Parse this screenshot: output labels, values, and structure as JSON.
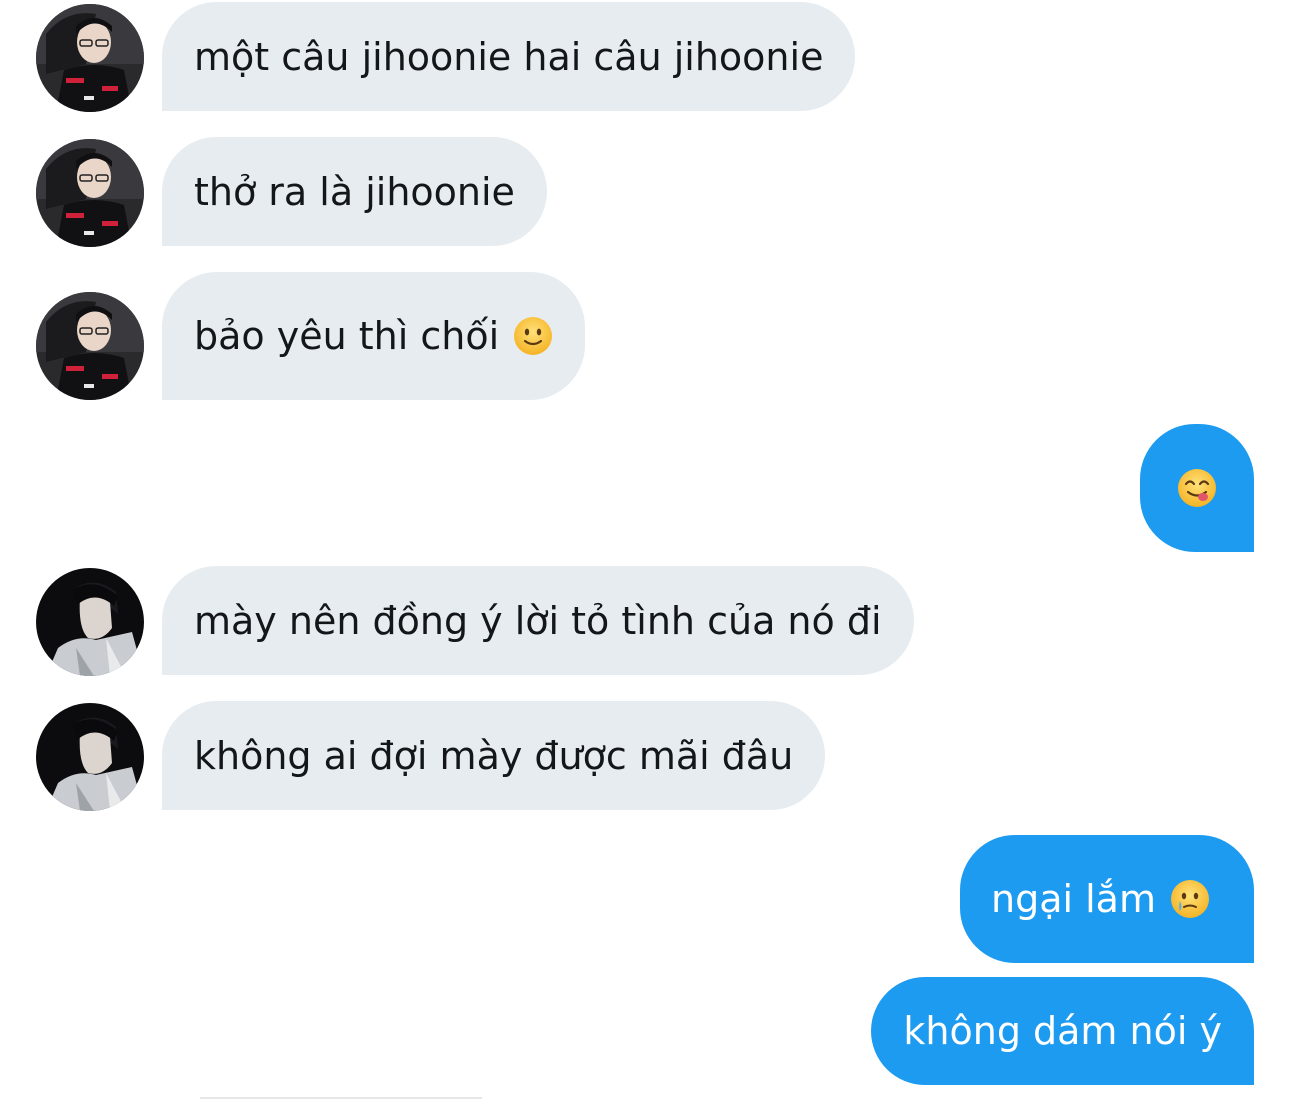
{
  "conversation": {
    "messages": [
      {
        "sender": "contact_a",
        "text": "một câu jihoonie hai câu jihoonie"
      },
      {
        "sender": "contact_a",
        "text": "thở ra là jihoonie"
      },
      {
        "sender": "contact_a",
        "text": "bảo yêu thì chối",
        "emoji": "slightly-smiling-face-emoji"
      },
      {
        "sender": "me",
        "text": "",
        "emoji": "face-savoring-food-emoji"
      },
      {
        "sender": "contact_b",
        "text": "mày nên đồng ý lời tỏ tình của nó đi"
      },
      {
        "sender": "contact_b",
        "text": "không ai đợi mày được mãi đâu"
      },
      {
        "sender": "me",
        "text": "ngại lắm",
        "emoji": "face-holding-back-tears-emoji"
      },
      {
        "sender": "me",
        "text": "không dám nói ý"
      }
    ]
  },
  "colors": {
    "incoming_bubble": "#e7ecf0",
    "outgoing_bubble": "#1d9bf0",
    "incoming_text": "#14171a",
    "outgoing_text": "#ffffff",
    "background": "#ffffff"
  }
}
